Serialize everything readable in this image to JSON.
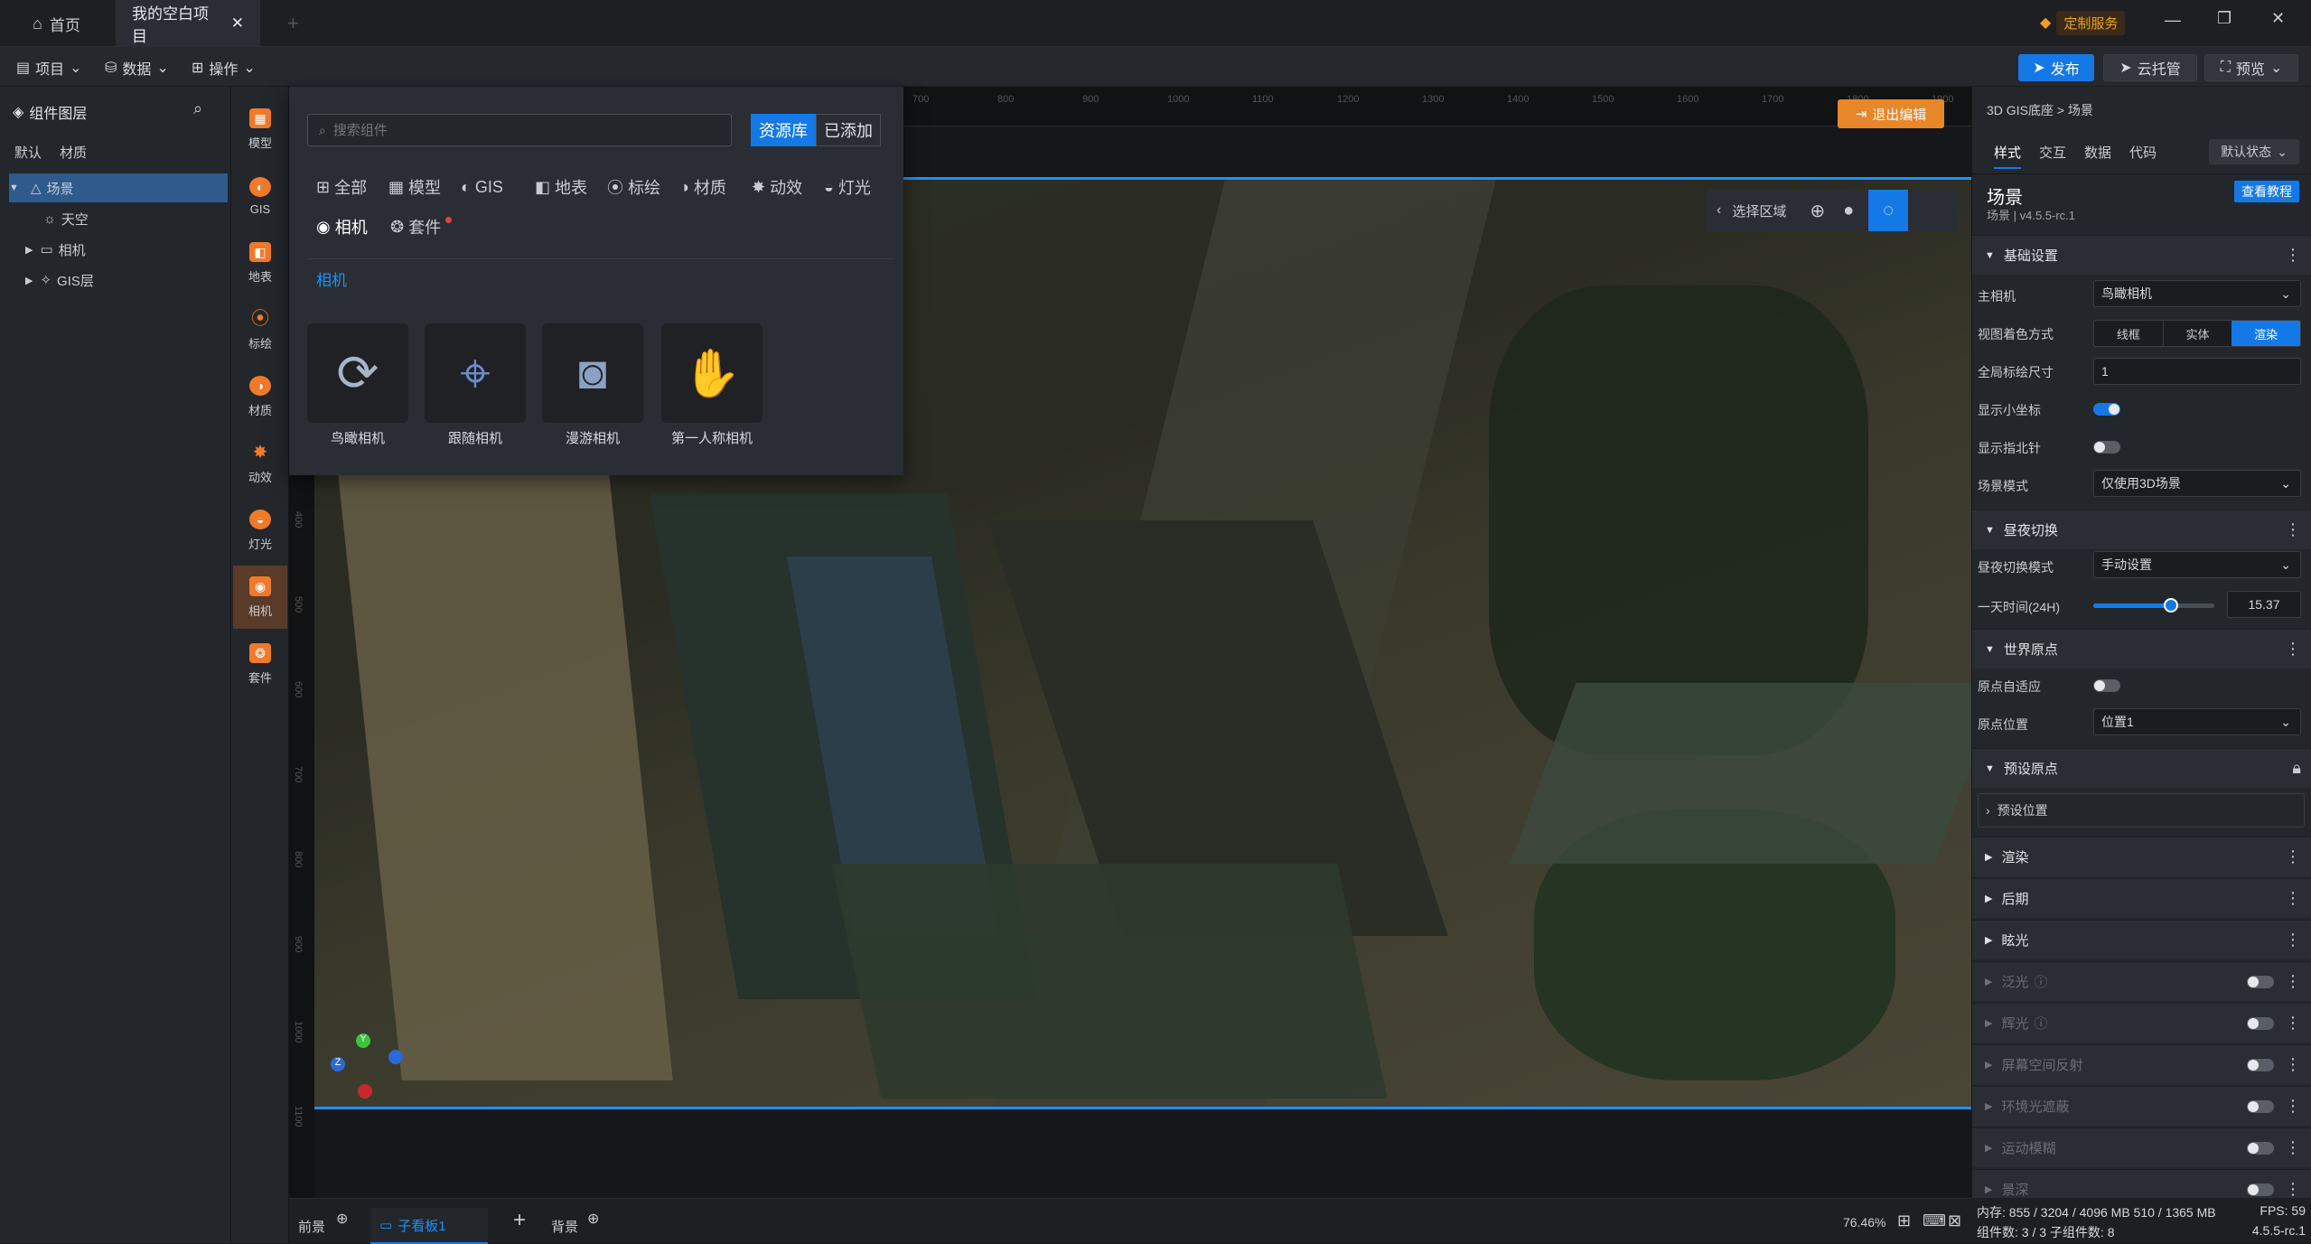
{
  "tabs": [
    {
      "label": "首页"
    },
    {
      "label": "我的空白项目"
    }
  ],
  "header": {
    "custom_service": "定制服务"
  },
  "toolbar": {
    "project": "项目",
    "data": "数据",
    "operate": "操作",
    "publish": "发布",
    "cloud_host": "云托管",
    "preview": "预览"
  },
  "layers": {
    "title": "组件图层",
    "tab_default": "默认",
    "tab_material": "材质",
    "items": [
      "场景",
      "天空",
      "相机",
      "GIS层"
    ]
  },
  "rail": [
    "模型",
    "GIS",
    "地表",
    "标绘",
    "材质",
    "动效",
    "灯光",
    "相机",
    "套件"
  ],
  "component_panel": {
    "search_placeholder": "搜索组件",
    "btn_library": "资源库",
    "btn_added": "已添加",
    "categories": [
      "全部",
      "模型",
      "GIS",
      "地表",
      "标绘",
      "材质",
      "动效",
      "灯光",
      "相机",
      "套件"
    ],
    "section_title": "相机",
    "cards": [
      "鸟瞰相机",
      "跟随相机",
      "漫游相机",
      "第一人称相机"
    ]
  },
  "canvas": {
    "exit_edit": "退出编辑",
    "select_area": "选择区域",
    "ruler_top": [
      "700",
      "800",
      "900",
      "1000",
      "1100",
      "1200",
      "1300",
      "1400",
      "1500",
      "1600",
      "1700",
      "1800",
      "1900",
      "2000"
    ],
    "ruler_left": [
      "400",
      "500",
      "600",
      "700",
      "800",
      "900",
      "1000",
      "1100"
    ],
    "zoom": "76.46%"
  },
  "bottom": {
    "foreground": "前景",
    "subview": "子看板1",
    "background": "背景"
  },
  "right_panel": {
    "breadcrumb": "3D GIS底座 > 场景",
    "tabs": [
      "样式",
      "交互",
      "数据",
      "代码"
    ],
    "state": "默认状态",
    "title": "场景",
    "subtitle": "场景 | v4.5.5-rc.1",
    "tutorial": "查看教程",
    "sections": {
      "basic": "基础设置",
      "daynight": "昼夜切换",
      "origin": "世界原点",
      "preset": "预设原点",
      "render": "渲染",
      "post": "后期",
      "glare": "眩光"
    },
    "rows": {
      "main_camera": "主相机",
      "main_camera_val": "鸟瞰相机",
      "view_mode": "视图着色方式",
      "view_opts": [
        "线框",
        "实体",
        "渲染"
      ],
      "label_size": "全局标绘尺寸",
      "label_size_val": "1",
      "show_axis": "显示小坐标",
      "show_compass": "显示指北针",
      "scene_mode": "场景模式",
      "scene_mode_val": "仅使用3D场景",
      "daynight_mode": "昼夜切换模式",
      "daynight_mode_val": "手动设置",
      "day_time": "一天时间(24H)",
      "day_time_val": "15.37",
      "day_time_fraction": 0.64,
      "origin_adapt": "原点自适应",
      "origin_pos": "原点位置",
      "origin_pos_val": "位置1",
      "preset_pos": "预设位置",
      "disabled": [
        "泛光",
        "辉光",
        "屏幕空间反射",
        "环境光遮蔽",
        "运动模糊",
        "景深"
      ]
    },
    "status": {
      "memory": "内存: 855 / 3204 / 4096 MB  510 / 1365 MB",
      "fps": "FPS: 59",
      "components": "组件数: 3 / 3  子组件数: 8",
      "version": "4.5.5-rc.1"
    }
  }
}
